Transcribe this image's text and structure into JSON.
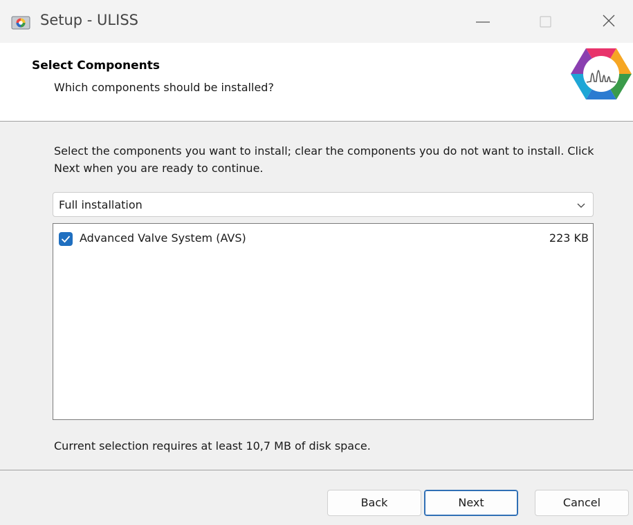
{
  "window": {
    "title": "Setup - ULISS",
    "app_icon": "installer-app-icon",
    "controls": [
      "minimize-icon",
      "maximize-icon",
      "close-icon"
    ]
  },
  "header": {
    "title": "Select Components",
    "subtitle": "Which components should be installed?",
    "logo": "uliss-hexagon-logo"
  },
  "main": {
    "instructions": "Select the components you want to install; clear the components you do not want to install. Click Next when you are ready to continue.",
    "install_type": {
      "selected": "Full installation",
      "icon": "chevron-down-icon"
    },
    "components": [
      {
        "label": "Advanced Valve System (AVS)",
        "size": "223 KB",
        "checked": true
      }
    ],
    "disk_space": "Current selection requires at least 10,7 MB of disk space."
  },
  "buttons": {
    "back": "Back",
    "next": "Next",
    "cancel": "Cancel"
  },
  "colors": {
    "accent": "#1f6fc0",
    "background": "#f0f0f0",
    "header_background": "#ffffff"
  }
}
